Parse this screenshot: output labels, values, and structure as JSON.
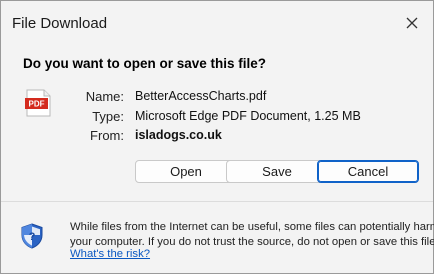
{
  "dialog": {
    "title": "File Download",
    "question": "Do you want to open or save this file?"
  },
  "file": {
    "icon": "pdf-file-icon",
    "icon_text": "PDF",
    "name_label": "Name:",
    "name_value": "BetterAccessCharts.pdf",
    "type_label": "Type:",
    "type_value": "Microsoft Edge PDF Document, 1.25 MB",
    "from_label": "From:",
    "from_value": "isladogs.co.uk"
  },
  "buttons": {
    "open": "Open",
    "save": "Save",
    "cancel": "Cancel"
  },
  "warning": {
    "line1": "While files from the Internet can be useful, some files can potentially harm",
    "line2": "your computer. If you do not trust the source, do not open or save this file.",
    "link": "What's the risk?"
  },
  "colors": {
    "link": "#0a58c2",
    "focus_border": "#0f62c8",
    "pdf_red": "#d42b1e"
  }
}
